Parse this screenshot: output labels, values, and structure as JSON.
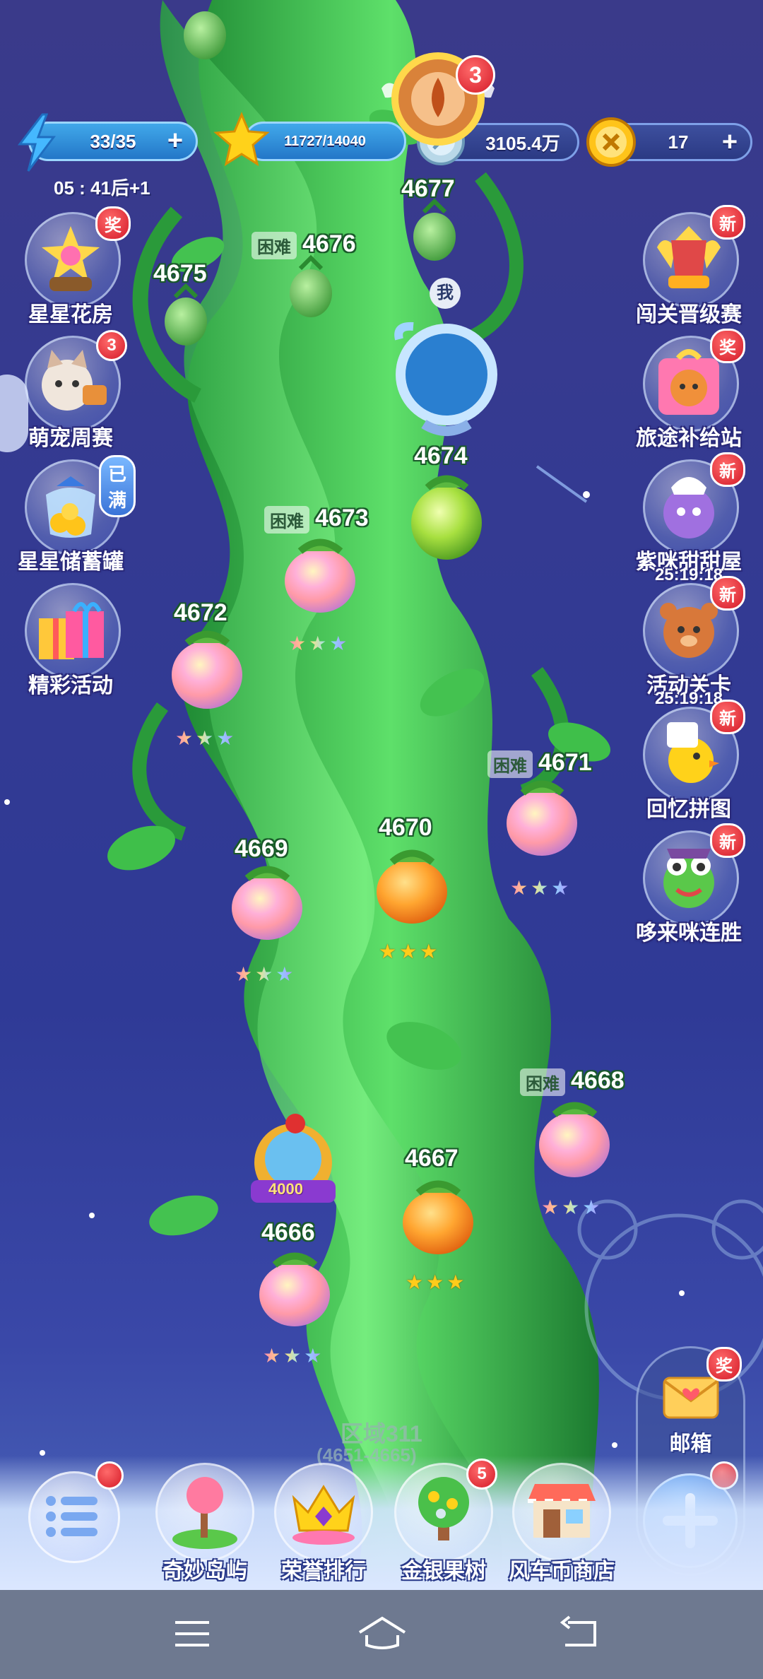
{
  "topbar": {
    "energy": "33/35",
    "energy_timer": "05 : 41后+1",
    "stars": "11727/14040",
    "silver": "3105.4万",
    "coins": "17",
    "chest_badge": "3"
  },
  "left_menu": [
    {
      "label": "星星花房",
      "tag": "奖"
    },
    {
      "label": "萌宠周赛",
      "badge": "3"
    },
    {
      "label": "星星储蓄罐",
      "tag": "已满"
    },
    {
      "label": "精彩活动"
    }
  ],
  "right_menu": [
    {
      "label": "闯关晋级赛",
      "tag": "新"
    },
    {
      "label": "旅途补给站",
      "tag": "奖"
    },
    {
      "label": "紫咪甜甜屋",
      "tag": "新",
      "timer": "25:19:18"
    },
    {
      "label": "活动关卡",
      "tag": "新",
      "timer": "25:19:18"
    },
    {
      "label": "回忆拼图",
      "tag": "新"
    },
    {
      "label": "哆来咪连胜",
      "tag": "新"
    }
  ],
  "levels": {
    "l4677": "4677",
    "l4676": "4676",
    "l4675": "4675",
    "l4674": "4674",
    "l4673": "4673",
    "l4672": "4672",
    "l4671": "4671",
    "l4670": "4670",
    "l4669": "4669",
    "l4668": "4668",
    "l4667": "4667",
    "l4666": "4666",
    "hard_label": "困难",
    "me_label": "我",
    "reward_value": "4000"
  },
  "stars_glyph": "★★★",
  "zone": {
    "title": "区域311",
    "range": "(4651-4665)"
  },
  "mailbox": {
    "label": "邮箱",
    "tag": "奖"
  },
  "bottom_nav": [
    {
      "label": "奇妙岛屿"
    },
    {
      "label": "荣誉排行"
    },
    {
      "label": "金银果树",
      "badge": "5"
    },
    {
      "label": "风车币商店"
    }
  ],
  "colors": {
    "stalk": "#3fbf4a",
    "background": "#343a92",
    "gold": "#ffcc1a",
    "badge": "#d41a28"
  }
}
